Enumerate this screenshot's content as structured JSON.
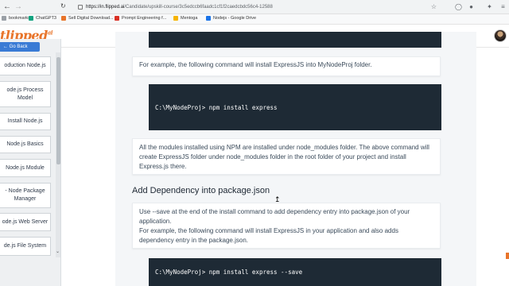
{
  "browser": {
    "url_host": "https://in.flipped.ai",
    "url_path": "/Candidate/upskill-course/3c5edccb6faadc1cf1f2caedcbdc56c4-12588",
    "bookmarks": [
      {
        "label": "bookmarks...",
        "icon": "folder-icon",
        "color": "#9aa0a6"
      },
      {
        "label": "ChatGPT3",
        "icon": "chatgpt-icon",
        "color": "#10a37f"
      },
      {
        "label": "Sell Digital Download...",
        "icon": "store-icon",
        "color": "#e8742a"
      },
      {
        "label": "Prompt Engineering f...",
        "icon": "prompt-icon",
        "color": "#d93025"
      },
      {
        "label": "Mentoga",
        "icon": "mentoga-icon",
        "color": "#f6b400"
      },
      {
        "label": "Nodejs - Google Drive",
        "icon": "drive-icon",
        "color": "#1a73e8"
      }
    ]
  },
  "app": {
    "logo_text": "tlipped",
    "logo_suffix": "ai",
    "brand_color": "#e8742a"
  },
  "sidebar": {
    "go_back_label": "← Go Back",
    "items": [
      {
        "label": "oduction Node.js"
      },
      {
        "label": "ode.js Process Model"
      },
      {
        "label": "Install Node.js"
      },
      {
        "label": "Node.js Basics"
      },
      {
        "label": "Node.js Module"
      },
      {
        "label": "- Node Package Manager"
      },
      {
        "label": "ode.js Web Server"
      },
      {
        "label": "de.js File System"
      }
    ]
  },
  "content": {
    "note1": "For example, the following command will install ExpressJS into MyNodeProj folder.",
    "code1": "C:\\MyNodeProj> npm install express",
    "note2": "All the modules installed using NPM are installed under node_modules folder. The above command will create ExpressJS folder under node_modules folder in the root folder of your project and install Express.js there.",
    "heading": "Add Dependency into package.json",
    "note3_line1": "Use --save at the end of the install command to add dependency entry into package.json of your application.",
    "note3_line2": "For example, the following command will install ExpressJS in your application and also adds dependency entry in the package.json.",
    "code2": "C:\\MyNodeProj> npm install express --save"
  }
}
